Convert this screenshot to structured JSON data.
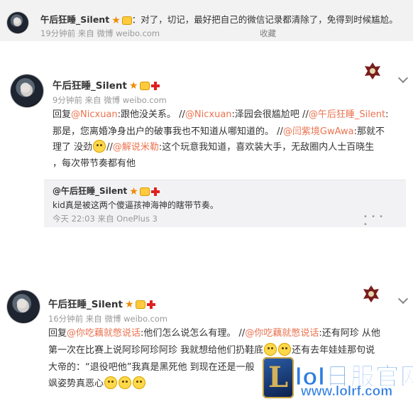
{
  "post1": {
    "username": "午后狂睡_Silent",
    "text": "：对了，切记，最好把自己的微信记录都清除了，免得到时候尴尬。",
    "time": "19分钟前",
    "source_prefix": "来自",
    "source": "微博 weibo.com",
    "favorite": "收藏"
  },
  "post2": {
    "username": "午后狂睡_Silent",
    "time": "9分钟前",
    "source_prefix": "来自",
    "source": "微博 weibo.com",
    "line1": {
      "prefix": "回复",
      "m1": "@Nicxuan",
      "t1": ":跟他没关系。 //",
      "m2": "@Nicxuan",
      "t2": ":泽园会很尴尬吧 //",
      "m3": "@午后狂睡_Silent",
      "t3": ":"
    },
    "line2": {
      "t1": "那是，您离婚净身出户的破事我也不知道从哪知道的。 //",
      "m1": "@闫紫境GwAwa",
      "t2": ":那就不"
    },
    "line3": {
      "t1": "理了 没劲",
      "t2": "//",
      "m1": "@解说米勒",
      "t3": ":这个玩意我知道，喜欢装大手，无敌圈内人士百晓生"
    },
    "line4": "，每次带节奏都有他",
    "reply": {
      "username": "@午后狂睡_Silent",
      "text": "kid真是被这两个傻逼孩神海神的瞎带节奏。",
      "time": "今天 22:03",
      "source_prefix": "来自",
      "source": "OnePlus 3"
    }
  },
  "post3": {
    "username": "午后狂睡_Silent",
    "time": "16分钟前",
    "source_prefix": "来自",
    "source": "微博 weibo.com",
    "line1": {
      "prefix": "回复",
      "m1": "@你吃藕就憋说话",
      "t1": ":他们怎么说怎么有理。 //",
      "m2": "@你吃藕就憋说话",
      "t2": ":还有阿珍 从他"
    },
    "line2": "第一次在比赛上说阿珍阿珍阿珍 我就想给他们扔鞋底",
    "line2b": "还有去年娃娃那句说",
    "line3": "大帝的：“退役吧他”我真是黑死他 到现在还是一般",
    "line4": "飒姿势真恶心"
  },
  "watermark": {
    "logo_letter": "L",
    "name": "lol日服官网",
    "url": "www.lolrf.com"
  },
  "colors": {
    "mention": "#eb7350",
    "meta": "#999999",
    "band": "#f2f2f2"
  }
}
